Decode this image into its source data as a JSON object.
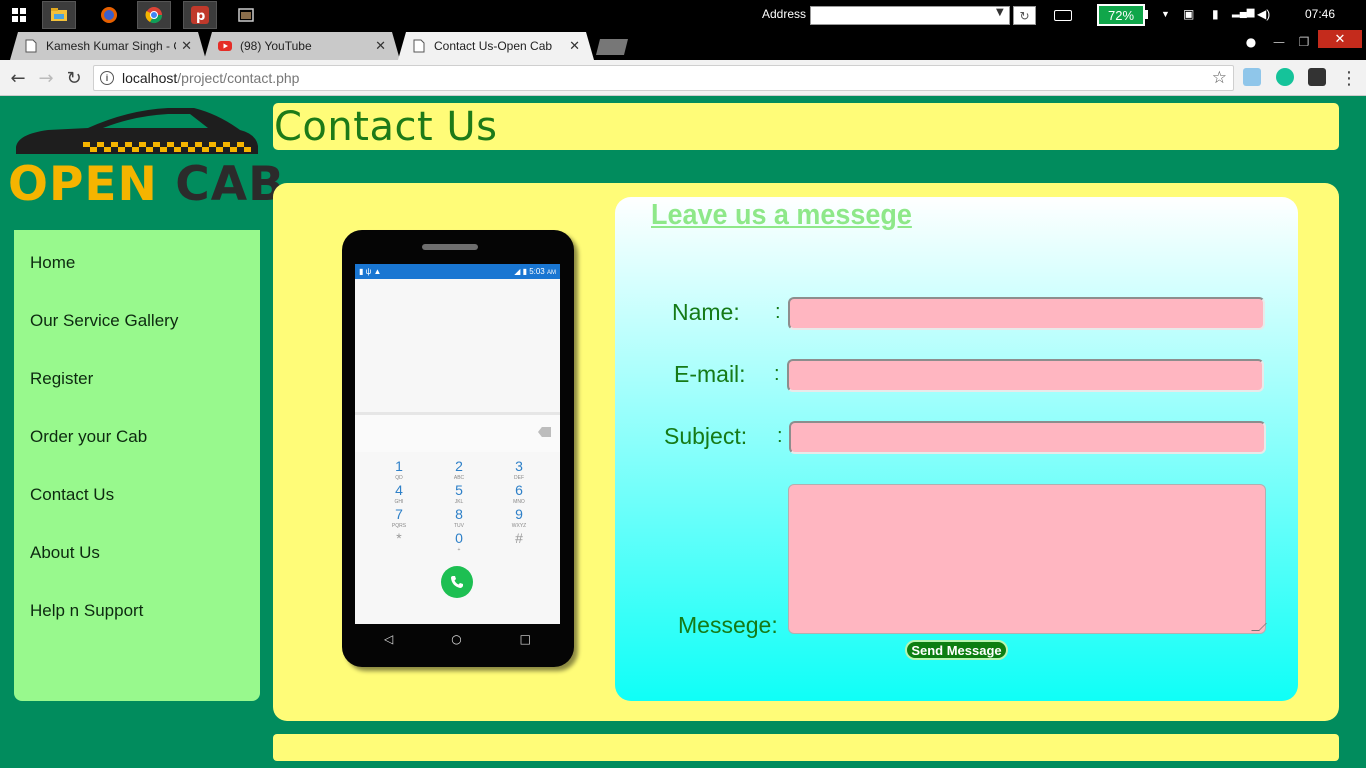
{
  "taskbar": {
    "address_label": "Address",
    "battery": "72%",
    "clock": "07:46"
  },
  "tabs": [
    {
      "label": "Kamesh Kumar Singh - C",
      "icon": "doc-icon"
    },
    {
      "label": "(98) YouTube",
      "icon": "youtube-icon"
    },
    {
      "label": "Contact Us-Open Cab",
      "icon": "doc-icon",
      "active": true
    }
  ],
  "toolbar": {
    "url_host": "localhost",
    "url_path": "/project/contact.php"
  },
  "logo": {
    "word1": "OPEN",
    "word2": "CAB"
  },
  "sidebar": {
    "items": [
      {
        "label": "Home"
      },
      {
        "label": "Our Service Gallery"
      },
      {
        "label": "Register"
      },
      {
        "label": "Order your Cab"
      },
      {
        "label": "Contact Us"
      },
      {
        "label": "About Us"
      },
      {
        "label": "Help n Support"
      }
    ]
  },
  "page": {
    "title": "Contact Us"
  },
  "phone": {
    "status_time": "5:03",
    "status_ampm": "AM",
    "keys": [
      {
        "d": "1",
        "l": "QD"
      },
      {
        "d": "2",
        "l": "ABC"
      },
      {
        "d": "3",
        "l": "DEF"
      },
      {
        "d": "4",
        "l": "GHI"
      },
      {
        "d": "5",
        "l": "JKL"
      },
      {
        "d": "6",
        "l": "MNO"
      },
      {
        "d": "7",
        "l": "PQRS"
      },
      {
        "d": "8",
        "l": "TUV"
      },
      {
        "d": "9",
        "l": "WXYZ"
      },
      {
        "d": "*",
        "l": ""
      },
      {
        "d": "0",
        "l": "+"
      },
      {
        "d": "#",
        "l": ""
      }
    ]
  },
  "form": {
    "heading": "Leave us a messege",
    "name_label": "Name:",
    "email_label": "E-mail:",
    "subject_label": "Subject:",
    "message_label": "Messege:",
    "colon": ":",
    "name_value": "",
    "email_value": "",
    "subject_value": "",
    "message_value": "",
    "send_label": "Send Message"
  },
  "colors": {
    "page_bg": "#018c5d",
    "banner": "#fffc78",
    "sidebar": "#98f98d",
    "input": "#ffb6c1",
    "label": "#157a17"
  }
}
